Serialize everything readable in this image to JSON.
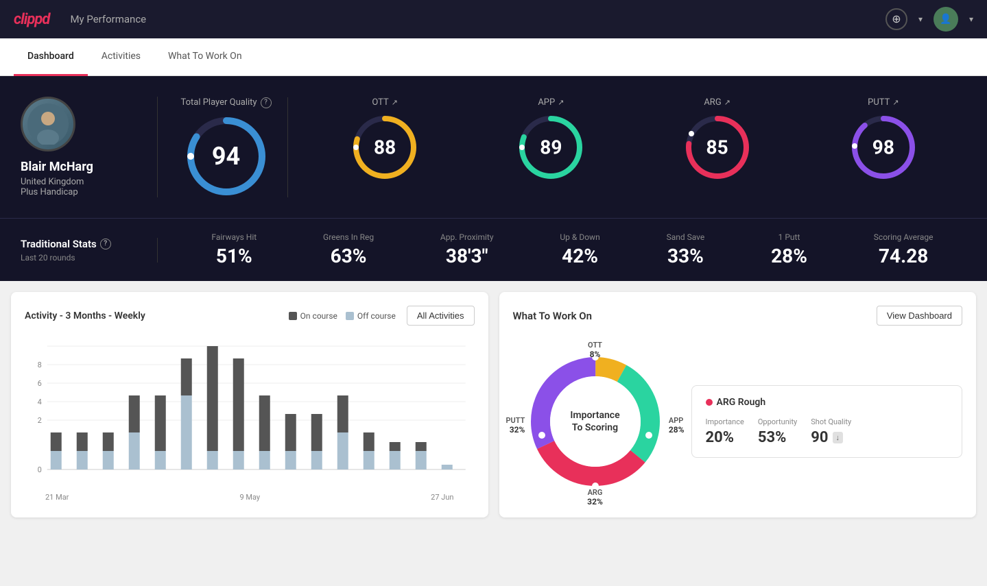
{
  "app": {
    "logo": "clippd",
    "header_title": "My Performance"
  },
  "tabs": [
    {
      "id": "dashboard",
      "label": "Dashboard",
      "active": true
    },
    {
      "id": "activities",
      "label": "Activities",
      "active": false
    },
    {
      "id": "what-to-work-on",
      "label": "What To Work On",
      "active": false
    }
  ],
  "player": {
    "name": "Blair McHarg",
    "country": "United Kingdom",
    "handicap": "Plus Handicap"
  },
  "total_quality": {
    "label": "Total Player Quality",
    "value": "94"
  },
  "categories": [
    {
      "id": "ott",
      "label": "OTT",
      "value": "88",
      "color": "#f0b020",
      "pct": 88
    },
    {
      "id": "app",
      "label": "APP",
      "value": "89",
      "color": "#2ad4a0",
      "pct": 89
    },
    {
      "id": "arg",
      "label": "ARG",
      "value": "85",
      "color": "#e8305a",
      "pct": 85
    },
    {
      "id": "putt",
      "label": "PUTT",
      "value": "98",
      "color": "#8b50e8",
      "pct": 98
    }
  ],
  "traditional_stats": {
    "title": "Traditional Stats",
    "subtitle": "Last 20 rounds",
    "stats": [
      {
        "label": "Fairways Hit",
        "value": "51%"
      },
      {
        "label": "Greens In Reg",
        "value": "63%"
      },
      {
        "label": "App. Proximity",
        "value": "38'3\""
      },
      {
        "label": "Up & Down",
        "value": "42%"
      },
      {
        "label": "Sand Save",
        "value": "33%"
      },
      {
        "label": "1 Putt",
        "value": "28%"
      },
      {
        "label": "Scoring Average",
        "value": "74.28"
      }
    ]
  },
  "activity_chart": {
    "title": "Activity - 3 Months - Weekly",
    "legend": [
      {
        "label": "On course",
        "color": "#555"
      },
      {
        "label": "Off course",
        "color": "#aac0d0"
      }
    ],
    "all_activities_btn": "All Activities",
    "x_labels": [
      "21 Mar",
      "9 May",
      "27 Jun"
    ],
    "bars": [
      {
        "on": 1,
        "off": 1
      },
      {
        "on": 1,
        "off": 1
      },
      {
        "on": 1,
        "off": 1
      },
      {
        "on": 2,
        "off": 2
      },
      {
        "on": 3,
        "off": 1
      },
      {
        "on": 4,
        "off": 4
      },
      {
        "on": 8,
        "off": 1
      },
      {
        "on": 7,
        "off": 1
      },
      {
        "on": 4,
        "off": 1
      },
      {
        "on": 3,
        "off": 1
      },
      {
        "on": 3,
        "off": 1
      },
      {
        "on": 2,
        "off": 2
      },
      {
        "on": 1,
        "off": 1
      },
      {
        "on": 0.5,
        "off": 1
      },
      {
        "on": 0.5,
        "off": 0.5
      },
      {
        "on": 0,
        "off": 0
      }
    ],
    "y_labels": [
      "0",
      "2",
      "4",
      "6",
      "8"
    ]
  },
  "what_to_work_on": {
    "title": "What To Work On",
    "view_dashboard_btn": "View Dashboard",
    "donut_center": "Importance\nTo Scoring",
    "segments": [
      {
        "label": "OTT",
        "value": "8%",
        "color": "#f0b020",
        "angle_start": 0,
        "angle_end": 29
      },
      {
        "label": "APP",
        "value": "28%",
        "color": "#2ad4a0",
        "angle_start": 29,
        "angle_end": 130
      },
      {
        "label": "ARG",
        "value": "32%",
        "color": "#e8305a",
        "angle_start": 130,
        "angle_end": 245
      },
      {
        "label": "PUTT",
        "value": "32%",
        "color": "#8b50e8",
        "angle_start": 245,
        "angle_end": 360
      }
    ],
    "info_card": {
      "title": "ARG Rough",
      "metrics": [
        {
          "label": "Importance",
          "value": "20%"
        },
        {
          "label": "Opportunity",
          "value": "53%"
        },
        {
          "label": "Shot Quality",
          "value": "90",
          "badge": "↓"
        }
      ]
    }
  }
}
